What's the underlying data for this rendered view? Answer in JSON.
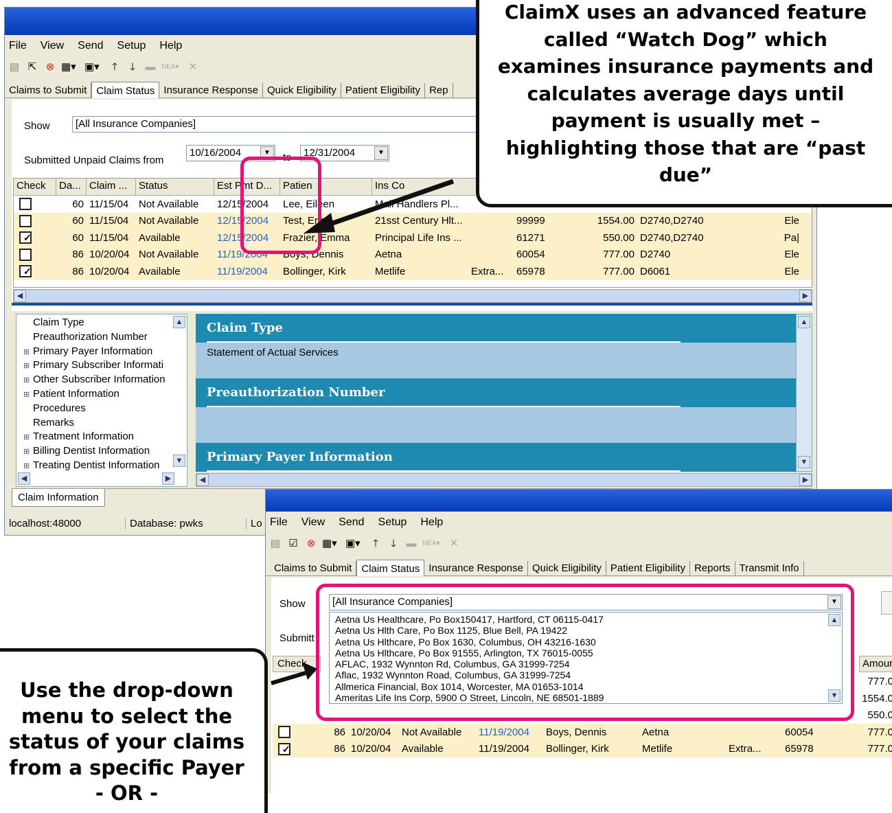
{
  "window1": {
    "menu": [
      "File",
      "View",
      "Send",
      "Setup",
      "Help"
    ],
    "tabs": [
      "Claims to Submit",
      "Claim Status",
      "Insurance Response",
      "Quick Eligibility",
      "Patient Eligibility",
      "Rep"
    ],
    "show_label": "Show",
    "show_value": "[All Insurance Companies]",
    "unpaid_label": "Submitted Unpaid Claims from",
    "from_date": "10/16/2004",
    "to_label": "to",
    "to_date": "12/31/2004",
    "columns": [
      "Check",
      "Da...",
      "Claim ...",
      "Status",
      "Est Pmt D...",
      "Patien",
      "Ins Co"
    ],
    "rows": [
      {
        "checked": false,
        "days": "60",
        "claim": "11/15/04",
        "status": "Not Available",
        "est": "12/15/2004",
        "patient": "Lee, Eileen",
        "ins": "Mail Handlers Pl...",
        "extra": "",
        "id": "",
        "amount": "",
        "codes": "",
        "type": "",
        "hl": false
      },
      {
        "checked": false,
        "days": "60",
        "claim": "11/15/04",
        "status": "Not Available",
        "est": "12/15/2004",
        "patient": "Test, Eric",
        "ins": "21sst Century Hlt...",
        "extra": "",
        "id": "99999",
        "amount": "1554.00",
        "codes": "D2740,D2740",
        "type": "Ele",
        "hl": true
      },
      {
        "checked": true,
        "days": "60",
        "claim": "11/15/04",
        "status": "Available",
        "est": "12/15/2004",
        "patient": "Frazier, Emma",
        "ins": "Principal Life Ins ...",
        "extra": "",
        "id": "61271",
        "amount": "550.00",
        "codes": "D2740,D2740",
        "type": "Pa|",
        "hl": true
      },
      {
        "checked": false,
        "days": "86",
        "claim": "10/20/04",
        "status": "Not Available",
        "est": "11/19/2004",
        "patient": "Boys, Dennis",
        "ins": "Aetna",
        "extra": "",
        "id": "60054",
        "amount": "777.00",
        "codes": "D2740",
        "type": "Ele",
        "hl": true
      },
      {
        "checked": true,
        "days": "86",
        "claim": "10/20/04",
        "status": "Available",
        "est": "11/19/2004",
        "patient": "Bollinger, Kirk",
        "ins": "Metlife",
        "extra": "Extra...",
        "id": "65978",
        "amount": "777.00",
        "codes": "D6061",
        "type": "Ele",
        "hl": true
      }
    ],
    "tree": [
      "Claim Type",
      "Preauthorization Number",
      "Primary Payer Information",
      "Primary Subscriber Informati",
      "Other Subscriber Information",
      "Patient Information",
      "Procedures",
      "Remarks",
      "Treatment Information",
      "Billing Dentist Information",
      "Treating Dentist Information"
    ],
    "sections": [
      {
        "title": "Claim Type",
        "body": "Statement of Actual Services"
      },
      {
        "title": "Preauthorization Number",
        "body": ""
      },
      {
        "title": "Primary Payer Information",
        "body": ""
      }
    ],
    "bottom_tab": "Claim Information",
    "status_host": "localhost:48000",
    "status_db": "Database: pwks",
    "status_lo": "Lo"
  },
  "window2": {
    "menu": [
      "File",
      "View",
      "Send",
      "Setup",
      "Help"
    ],
    "tabs": [
      "Claims to Submit",
      "Claim Status",
      "Insurance Response",
      "Quick Eligibility",
      "Patient Eligibility",
      "Reports",
      "Transmit Info"
    ],
    "show_label": "Show",
    "show_value": "[All Insurance Companies]",
    "submit_label": "Submitt",
    "check_label": "Check",
    "amount_label": "Amour",
    "options": [
      "Aetna Us Healthcare, Po Box150417, Hartford, CT 06115-0417",
      "Aetna Us Hlth Care, Po Box 1125, Blue Bell, PA 19422",
      "Aetna Us Hlthcare, Po Box 1630, Columbus, OH 43216-1630",
      "Aetna Us Hlthcare, Po Box 91555, Arlington, TX 76015-0055",
      "AFLAC, 1932  Wynnton Rd, Columbus, GA 31999-7254",
      "Aflac, 1932 Wynnton Road, Columbus, GA 31999-7254",
      "Allmerica Financial, Box 1014, Worcester, MA 01653-1014",
      "Ameritas Life Ins Corp, 5900 O Street, Lincoln, NE 68501-1889"
    ],
    "side_amounts": [
      "777.0",
      "1554.0",
      "550.0"
    ],
    "rows": [
      {
        "checked": false,
        "days": "86",
        "claim": "10/20/04",
        "status": "Not Available",
        "est": "11/19/2004",
        "patient": "Boys, Dennis",
        "ins": "Aetna",
        "extra": "",
        "id": "60054",
        "amount": "777.0"
      },
      {
        "checked": true,
        "days": "86",
        "claim": "10/20/04",
        "status": "Available",
        "est": "11/19/2004",
        "patient": "Bollinger, Kirk",
        "ins": "Metlife",
        "extra": "Extra...",
        "id": "65978",
        "amount": "777.0"
      }
    ]
  },
  "callout_top": "ClaimX uses an advanced feature called “Watch Dog” which examines insurance payments and calculates average days until payment is usually met – highlighting those that are “past due”",
  "callout_bottom": "Use the drop-down menu to select the status of your claims from a specific Payer - OR -"
}
